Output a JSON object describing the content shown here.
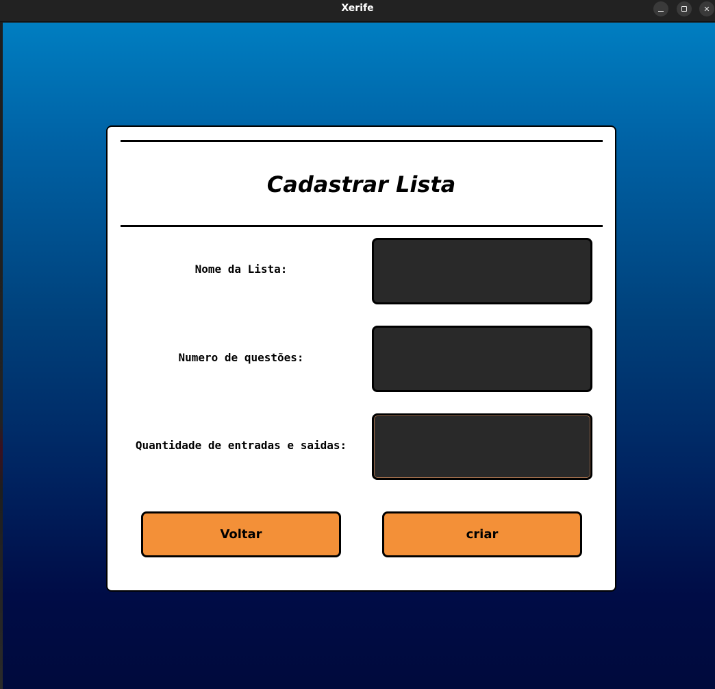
{
  "window": {
    "title": "Xerife",
    "controls": {
      "minimize": "minimize-icon",
      "maximize": "maximize-icon",
      "close": "close-icon",
      "close_glyph": "✕"
    }
  },
  "form": {
    "title": "Cadastrar Lista",
    "fields": [
      {
        "label": "Nome da Lista:",
        "value": ""
      },
      {
        "label": "Numero de questões:",
        "value": ""
      },
      {
        "label": "Quantidade de entradas e saidas:",
        "value": ""
      }
    ],
    "buttons": {
      "back": "Voltar",
      "create": "criar"
    }
  },
  "colors": {
    "button_bg": "#f39038",
    "field_bg": "#292929",
    "gradient_top": "#007ec1",
    "gradient_bottom": "#000a3c"
  }
}
